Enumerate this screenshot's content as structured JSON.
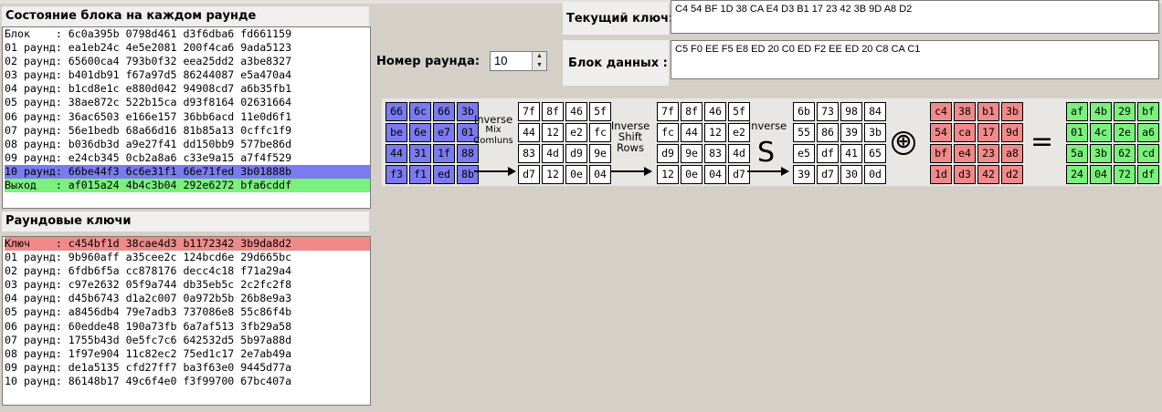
{
  "state_panel": {
    "title": "Состояние блока на каждом раунде",
    "rows": [
      "Блок    : 6c0a395b 0798d461 d3f6dba6 fd661159",
      "01 раунд: ea1eb24c 4e5e2081 200f4ca6 9ada5123",
      "02 раунд: 65600ca4 793b0f32 eea25dd2 a3be8327",
      "03 раунд: b401db91 f67a97d5 86244087 e5a470a4",
      "04 раунд: b1cd8e1c e880d042 94908cd7 a6b35fb1",
      "05 раунд: 38ae872c 522b15ca d93f8164 02631664",
      "06 раунд: 36ac6503 e166e157 36bb6acd 11e0d6f1",
      "07 раунд: 56e1bedb 68a66d16 81b85a13 0cffc1f9",
      "08 раунд: b036db3d a9e27f41 dd150bb9 577be86d",
      "09 раунд: e24cb345 0cb2a8a6 c33e9a15 a7f4f529",
      "10 раунд: 66be44f3 6c6e31f1 66e71fed 3b01888b",
      "Выход   : af015a24 4b4c3b04 292e6272 bfa6cddf"
    ]
  },
  "keys_panel": {
    "title": "Раундовые ключи",
    "rows": [
      "Ключ    : c454bf1d 38cae4d3 b1172342 3b9da8d2",
      "01 раунд: 9b960aff a35cee2c 124bcd6e 29d665bc",
      "02 раунд: 6fdb6f5a cc878176 decc4c18 f71a29a4",
      "03 раунд: c97e2632 05f9a744 db35eb5c 2c2fc2f8",
      "04 раунд: d45b6743 d1a2c007 0a972b5b 26b8e9a3",
      "05 раунд: a8456db4 79e7adb3 737086e8 55c86f4b",
      "06 раунд: 60edde48 190a73fb 6a7af513 3fb29a58",
      "07 раунд: 1755b43d 0e5fc7c6 642532d5 5b97a88d",
      "08 раунд: 1f97e904 11c82ec2 75ed1c17 2e7ab49a",
      "09 раунд: de1a5135 cfd27ff7 ba3f63e0 9445d77a",
      "10 раунд: 86148b17 49c6f4e0 f3f99700 67bc407a"
    ]
  },
  "controls": {
    "round_label": "Номер раунда:",
    "round_value": "10",
    "key_label": "Текущий ключ:",
    "key_value": "C4 54 BF 1D 38 CA E4 D3 B1 17 23 42 3B 9D A8 D2",
    "data_label": "Блок данных :",
    "data_value": "C5 F0 EE F5 E8 ED 20 C0 ED F2 EE ED 20 C8 CA C1"
  },
  "operations": {
    "inv_mix": [
      "Inverse",
      "Mix",
      "Comluns"
    ],
    "inv_shift": [
      "Inverse",
      "Shift",
      "Rows"
    ],
    "inv_sub": [
      "Inverse"
    ],
    "inv_sub_symbol": "S",
    "xor_symbol": "⊕",
    "equals_symbol": "="
  },
  "matrices": {
    "input": [
      "66",
      "6c",
      "66",
      "3b",
      "be",
      "6e",
      "e7",
      "01",
      "44",
      "31",
      "1f",
      "88",
      "f3",
      "f1",
      "ed",
      "8b"
    ],
    "after_mix": [
      "7f",
      "8f",
      "46",
      "5f",
      "44",
      "12",
      "e2",
      "fc",
      "83",
      "4d",
      "d9",
      "9e",
      "d7",
      "12",
      "0e",
      "04"
    ],
    "after_shift": [
      "7f",
      "8f",
      "46",
      "5f",
      "fc",
      "44",
      "12",
      "e2",
      "d9",
      "9e",
      "83",
      "4d",
      "12",
      "0e",
      "04",
      "d7"
    ],
    "after_sub": [
      "6b",
      "73",
      "98",
      "84",
      "55",
      "86",
      "39",
      "3b",
      "e5",
      "df",
      "41",
      "65",
      "39",
      "d7",
      "30",
      "0d"
    ],
    "key": [
      "c4",
      "38",
      "b1",
      "3b",
      "54",
      "ca",
      "17",
      "9d",
      "bf",
      "e4",
      "23",
      "a8",
      "1d",
      "d3",
      "42",
      "d2"
    ],
    "output": [
      "af",
      "4b",
      "29",
      "bf",
      "01",
      "4c",
      "2e",
      "a6",
      "5a",
      "3b",
      "62",
      "cd",
      "24",
      "04",
      "72",
      "df"
    ]
  },
  "colors": {
    "selected_row": "#7b7bf0",
    "output_row": "#7cf07c",
    "key_row": "#f08a8a"
  }
}
